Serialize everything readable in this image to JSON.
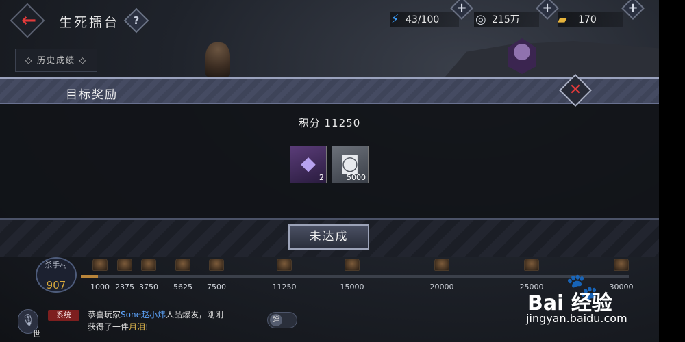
{
  "header": {
    "title": "生死擂台",
    "back_icon": "back-arrow-icon",
    "help_label": "?"
  },
  "resources": {
    "energy": {
      "icon": "lightning-icon",
      "value": "43/100",
      "color": "#3da0ff"
    },
    "coins": {
      "icon": "coin-icon",
      "value": "215万"
    },
    "ingots": {
      "icon": "gold-ingot-icon",
      "value": "170",
      "color": "#e7b43c"
    },
    "add_label": "+"
  },
  "history_button": {
    "label": "◇ 历史成绩 ◇"
  },
  "modal": {
    "title": "目标奖励",
    "score_text": "积分 11250",
    "close_label": "✕",
    "rewards": [
      {
        "icon": "crystal-icon",
        "count": "2"
      },
      {
        "icon": "silver-coin-icon",
        "count": "5000"
      }
    ],
    "status_button": "未达成"
  },
  "progress": {
    "rank_label": "杀手村",
    "rank_value": "907",
    "current_score": 907,
    "max_score": 30000,
    "milestones": [
      "1000",
      "2375",
      "3750",
      "5625",
      "7500",
      "11250",
      "15000",
      "20000",
      "25000",
      "30000"
    ]
  },
  "chat": {
    "channel": "世",
    "tag": "系统",
    "line1_prefix": "恭喜玩家",
    "player_name": "Sone赵小炜",
    "line1_suffix": "人品爆发，刚刚",
    "line2_prefix": "获得了一件",
    "item_name": "月泪",
    "line2_suffix": "!",
    "barrage_label": "弹"
  },
  "watermark": {
    "brand": "Bai 经验",
    "url": "jingyan.baidu.com"
  },
  "colors": {
    "accent_red": "#e23a3a",
    "gold": "#e1b84d",
    "link_blue": "#5ea6ff"
  }
}
